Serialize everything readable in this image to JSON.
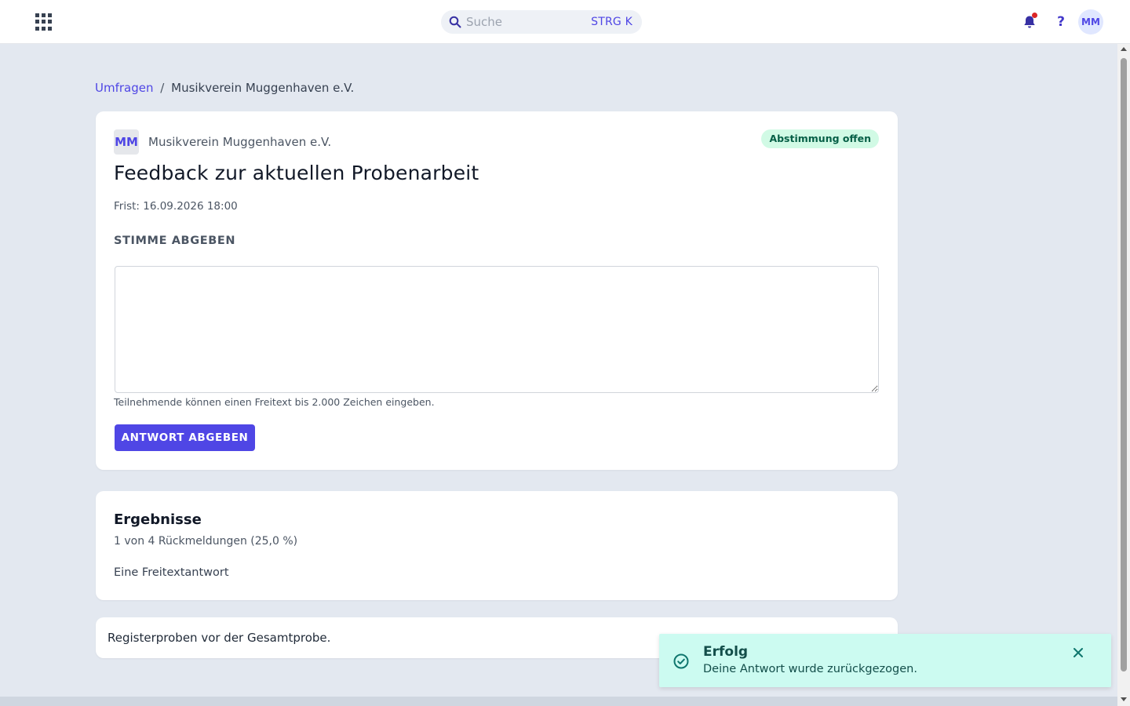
{
  "topbar": {
    "search_placeholder": "Suche",
    "search_shortcut": "STRG K",
    "user_initials": "MM",
    "help_label": "?"
  },
  "breadcrumb": {
    "parent": "Umfragen",
    "separator": "/",
    "current": "Musikverein Muggenhaven e.V."
  },
  "poll": {
    "org_initials": "MM",
    "org_name": "Musikverein Muggenhaven e.V.",
    "status": "Abstimmung offen",
    "title": "Feedback zur aktuellen Probenarbeit",
    "deadline": "Frist: 16.09.2026 18:00",
    "section_label": "STIMME ABGEBEN",
    "answer_value": "",
    "hint": "Teilnehmende können einen Freitext bis 2.000 Zeichen eingeben.",
    "submit_label": "ANTWORT ABGEBEN"
  },
  "results": {
    "title": "Ergebnisse",
    "summary": "1 von 4 Rückmeldungen (25,0 %)",
    "type_label": "Eine Freitextantwort",
    "answers": [
      "Registerproben vor der Gesamtprobe."
    ]
  },
  "toast": {
    "title": "Erfolg",
    "message": "Deine Antwort wurde zurückgezogen."
  },
  "colors": {
    "accent": "#4f46e5",
    "background": "#e3e8f0",
    "status_badge_bg": "#d1fae5",
    "toast_bg": "#ccfbf1",
    "notification_dot": "#dc2626"
  },
  "icons": [
    "apps-grid-icon",
    "search-icon",
    "bell-icon",
    "help-icon",
    "check-circle-icon",
    "close-icon"
  ]
}
